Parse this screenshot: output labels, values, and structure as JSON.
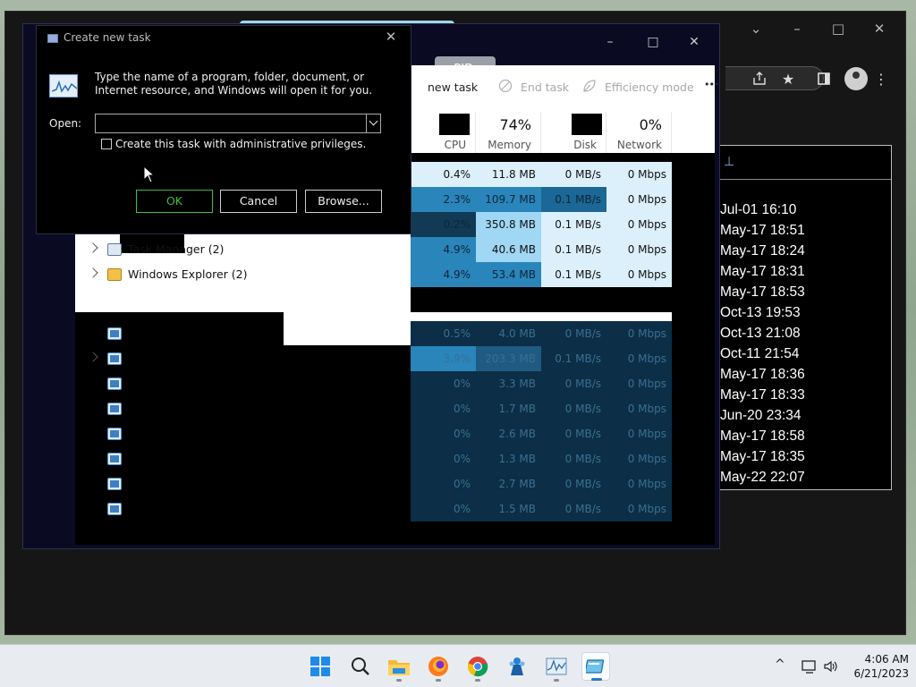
{
  "chrome": {
    "minimize": "⌄",
    "min2": "–",
    "maximize": "□",
    "close": "✕",
    "share_icon": "share-icon",
    "star_icon": "★",
    "sidebar_icon": "sidebar-icon",
    "menu_icon": "⋮"
  },
  "datelist": [
    "Jul-01 16:10",
    "May-17 18:51",
    "May-17 18:24",
    "May-17 18:31",
    "May-17 18:53",
    "Oct-13 19:53",
    "Oct-13 21:08",
    "Oct-11 21:54",
    "May-17 18:36",
    "May-17 18:33",
    "Jun-20 23:34",
    "May-17 18:58",
    "May-17 18:35",
    "May-22 22:07"
  ],
  "taskmanager": {
    "search_text": "or PID...",
    "minimize": "–",
    "maximize": "□",
    "close": "✕",
    "toolbar": {
      "run_new_task": "new task",
      "end_task": "End task",
      "efficiency_mode": "Efficiency mode",
      "more": "•••"
    },
    "headers": {
      "cpu": {
        "pct": "",
        "label": "CPU"
      },
      "memory": {
        "pct": "74%",
        "label": "Memory"
      },
      "disk": {
        "pct": "",
        "label": "Disk"
      },
      "network": {
        "pct": "0%",
        "label": "Network"
      }
    },
    "rows": [
      {
        "name": "",
        "cpu": "0.4%",
        "memory": "11.8 MB",
        "disk": "0 MB/s",
        "network": "0 Mbps"
      },
      {
        "name": "",
        "cpu": "2.3%",
        "memory": "109.7 MB",
        "disk": "0.1 MB/s",
        "network": "0 Mbps"
      },
      {
        "name": "",
        "cpu": "0.2%",
        "memory": "350.8 MB",
        "disk": "0.1 MB/s",
        "network": "0 Mbps"
      },
      {
        "name": "Task Manager (2)",
        "cpu": "4.9%",
        "memory": "40.6 MB",
        "disk": "0.1 MB/s",
        "network": "0 Mbps"
      },
      {
        "name": "Windows Explorer (2)",
        "cpu": "4.9%",
        "memory": "53.4 MB",
        "disk": "0.1 MB/s",
        "network": "0 Mbps"
      },
      {
        "name": "",
        "cpu": "0.5%",
        "memory": "4.0 MB",
        "disk": "0 MB/s",
        "network": "0 Mbps"
      },
      {
        "name": "",
        "cpu": "3.9%",
        "memory": "203.3 MB",
        "disk": "0.1 MB/s",
        "network": "0 Mbps"
      },
      {
        "name": "",
        "cpu": "0%",
        "memory": "3.3 MB",
        "disk": "0 MB/s",
        "network": "0 Mbps"
      },
      {
        "name": "",
        "cpu": "0%",
        "memory": "1.7 MB",
        "disk": "0 MB/s",
        "network": "0 Mbps"
      },
      {
        "name": "",
        "cpu": "0%",
        "memory": "2.6 MB",
        "disk": "0 MB/s",
        "network": "0 Mbps"
      },
      {
        "name": "",
        "cpu": "0%",
        "memory": "1.3 MB",
        "disk": "0 MB/s",
        "network": "0 Mbps"
      },
      {
        "name": "",
        "cpu": "0%",
        "memory": "2.7 MB",
        "disk": "0 MB/s",
        "network": "0 Mbps"
      },
      {
        "name": "",
        "cpu": "0%",
        "memory": "1.5 MB",
        "disk": "0 MB/s",
        "network": "0 Mbps"
      }
    ]
  },
  "run_dialog": {
    "title": "Create new task",
    "close": "✕",
    "message": "Type the name of a program, folder, document, or Internet resource, and Windows will open it for you.",
    "open_label": "Open:",
    "open_value": "",
    "admin_checkbox_label": "Create this task with administrative privileges.",
    "admin_checked": false,
    "ok": "OK",
    "cancel": "Cancel",
    "browse": "Browse..."
  },
  "taskbar": {
    "time": "4:06 AM",
    "date": "6/21/2023",
    "tray_chevron": "^"
  },
  "colors": {
    "accent": "#2a79c9",
    "heat_light": "#dcf0fb",
    "heat_mid": "#9fd7f4",
    "heat_dark": "#2a85bb",
    "heat_deep": "#1b6795",
    "ok_green": "#3fbf3f"
  }
}
